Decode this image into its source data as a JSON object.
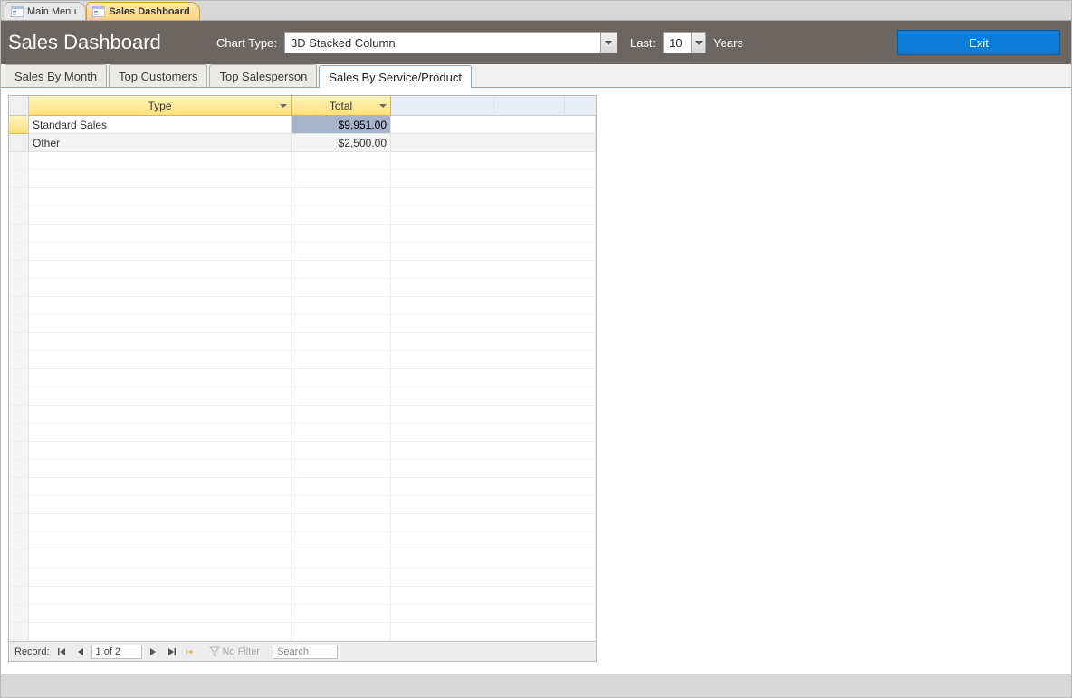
{
  "window_tabs": [
    {
      "label": "Main Menu",
      "active": false
    },
    {
      "label": "Sales Dashboard",
      "active": true
    }
  ],
  "header": {
    "title": "Sales Dashboard",
    "chart_type_label": "Chart Type:",
    "chart_type_value": "3D Stacked Column.",
    "last_label": "Last:",
    "last_value": "10",
    "years_label": "Years",
    "exit_label": "Exit"
  },
  "inner_tabs": [
    {
      "label": "Sales By Month",
      "active": false
    },
    {
      "label": "Top Customers",
      "active": false
    },
    {
      "label": "Top Salesperson",
      "active": false
    },
    {
      "label": "Sales By Service/Product",
      "active": true
    }
  ],
  "grid": {
    "columns": [
      "Type",
      "Total"
    ],
    "rows": [
      {
        "type": "Standard Sales",
        "total": "$9,951.00"
      },
      {
        "type": "Other",
        "total": "$2,500.00"
      }
    ]
  },
  "record_nav": {
    "label": "Record:",
    "position": "1 of 2",
    "no_filter_label": "No Filter",
    "search_placeholder": "Search"
  },
  "colors": {
    "header_bg": "#6c6663",
    "exit_bg": "#0b7dd8",
    "tab_active_bg": "#ffd47a",
    "col_header_bg": "#ffe07a",
    "selected_cell_bg": "#a7b4cc"
  }
}
